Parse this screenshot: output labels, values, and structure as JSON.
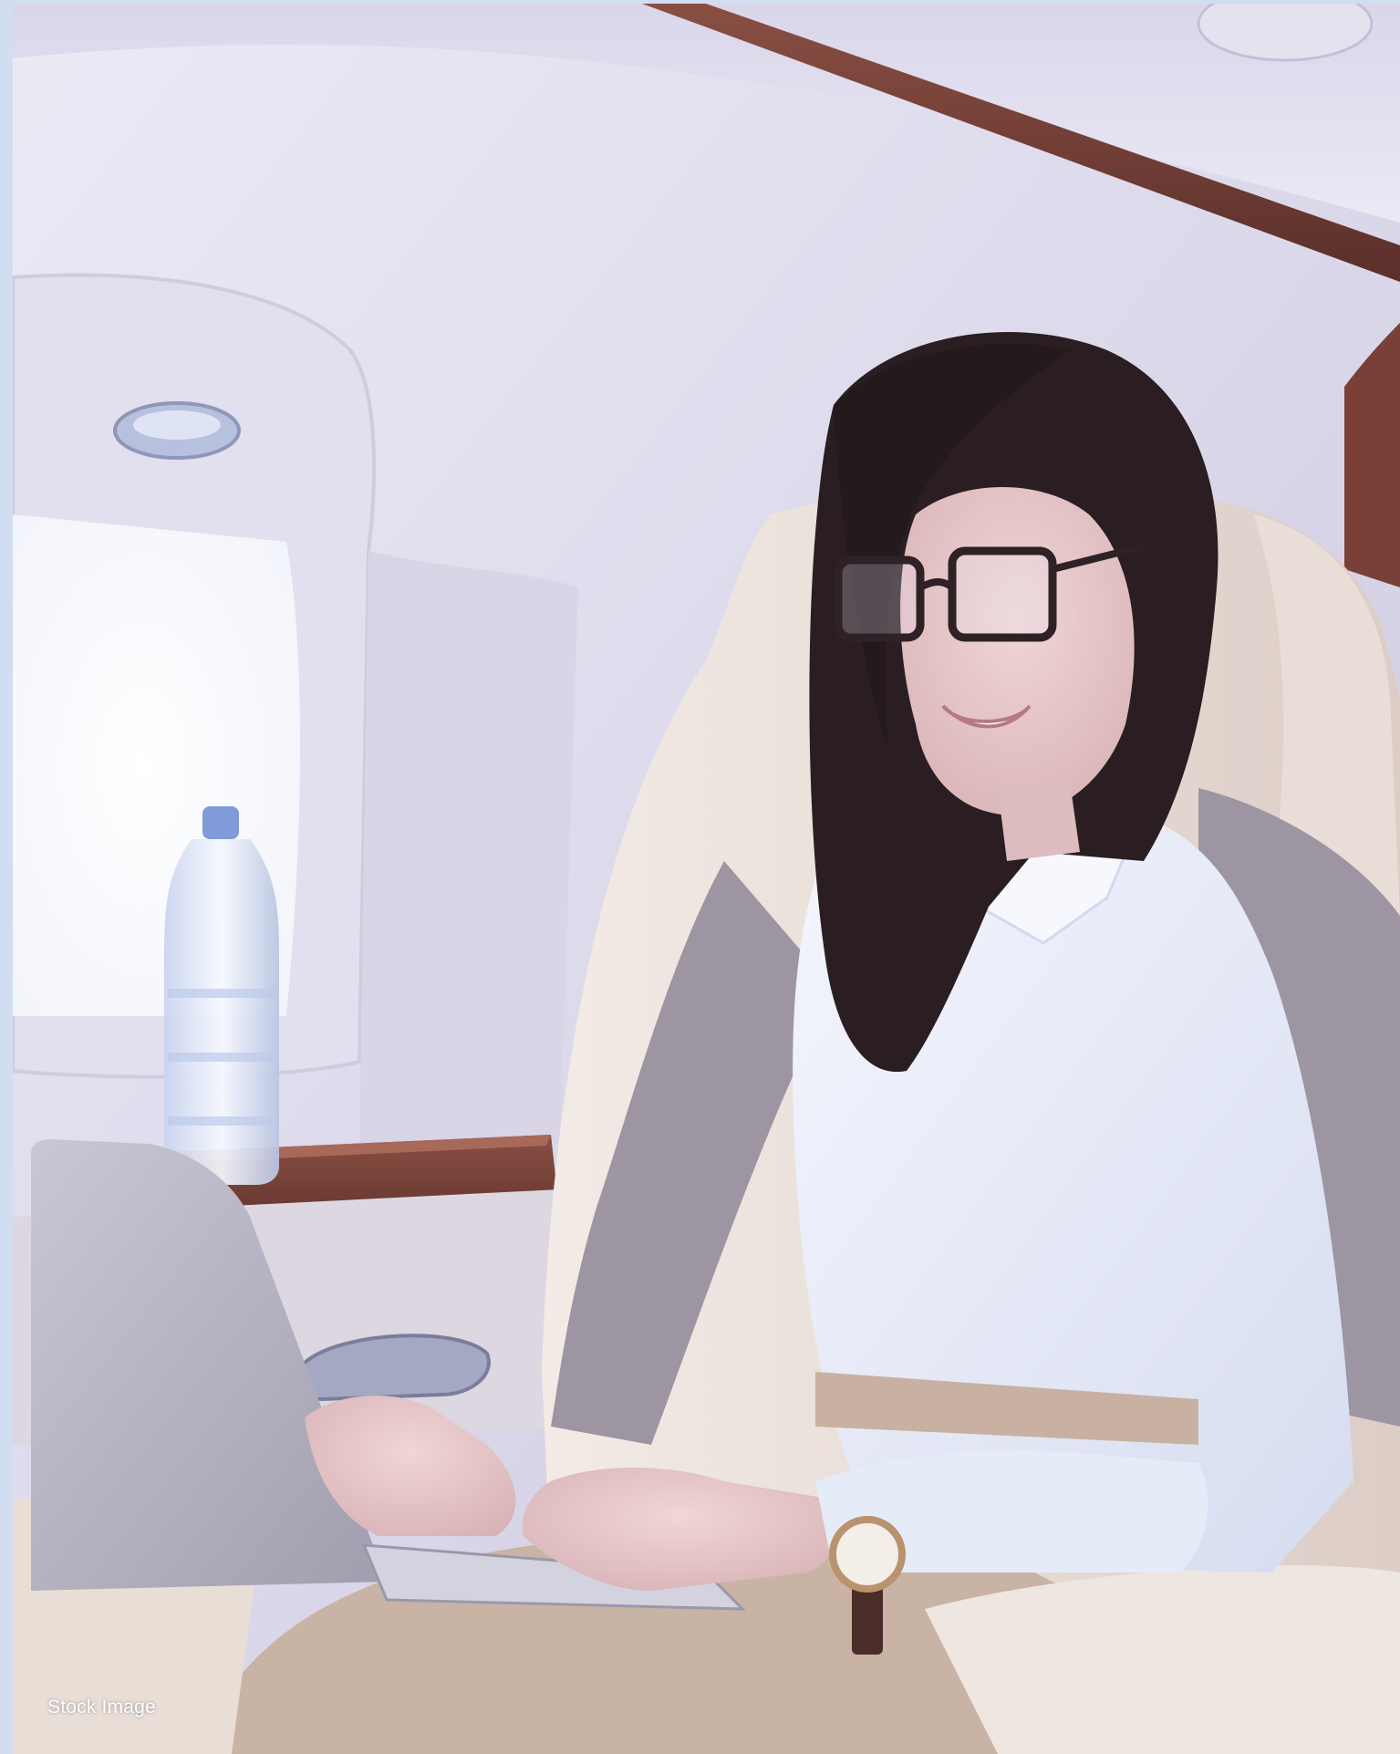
{
  "caption": "Stock Image",
  "colors": {
    "frame": "#d3ddf2",
    "cabin_wall": "#e6e4f1",
    "wood_trim": "#6b3b33",
    "seat_leather": "#eadfd8",
    "shirt": "#e9edf9",
    "cardigan": "#9e95a2",
    "hair": "#2a1e22",
    "laptop": "#b8b6c4",
    "trousers": "#c9b3a5"
  },
  "scene": {
    "subject": "woman-with-glasses-typing-on-laptop",
    "objects": [
      "cabin-window",
      "water-bottle",
      "wood-side-table",
      "cabin-light",
      "armrest-handle",
      "leather-seat",
      "wristwatch"
    ]
  }
}
